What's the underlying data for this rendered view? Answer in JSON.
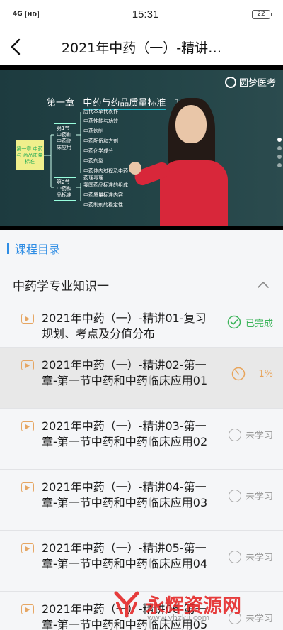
{
  "status_bar": {
    "signal": "4G",
    "hd": "HD",
    "time": "15:31",
    "battery": "22"
  },
  "nav": {
    "title": "2021年中药（一）-精讲…"
  },
  "video": {
    "logo_text": "圆梦医考",
    "slide_heading_prefix": "第一章",
    "slide_heading_main": "中药与药品质量标准",
    "slide_heading_suffix": "15分",
    "mind_root": "第一章 中药与 药品质量标准",
    "mind_nodes": [
      "第1节 中药和 中药临 床应用",
      "第2节 中药和 品标准"
    ],
    "mind_leaves": [
      "历代本草代表作",
      "中药性能与功效",
      "中药炮制",
      "中药配伍和方剂",
      "中药化学成分",
      "中药剂型",
      "中药体内过程及中药药理毒理",
      "我国药品标准的组成",
      "中药质量标准内容",
      "中药制剂的稳定性"
    ]
  },
  "catalog": {
    "label": "课程目录"
  },
  "group": {
    "label": "中药学专业知识一"
  },
  "lessons": [
    {
      "title": "2021年中药（一）-精讲01-复习规划、考点及分值分布",
      "status": "已完成"
    },
    {
      "title": "2021年中药（一）-精讲02-第一章-第一节中药和中药临床应用01",
      "status": "1%"
    },
    {
      "title": "2021年中药（一）-精讲03-第一章-第一节中药和中药临床应用02",
      "status": "未学习"
    },
    {
      "title": "2021年中药（一）-精讲04-第一章-第一节中药和中药临床应用03",
      "status": "未学习"
    },
    {
      "title": "2021年中药（一）-精讲05-第一章-第一节中药和中药临床应用04",
      "status": "未学习"
    },
    {
      "title": "2021年中药（一）-精讲06-第一章-第一节中药和中药临床应用05",
      "status": "未学习"
    }
  ],
  "watermark": {
    "text": "永辉资源网",
    "url": "www.yhzkjj.com"
  },
  "colors": {
    "accent": "#2f8de4",
    "done": "#3cb45a",
    "progress": "#e8a45a",
    "presenter_dress": "#d8273a"
  }
}
